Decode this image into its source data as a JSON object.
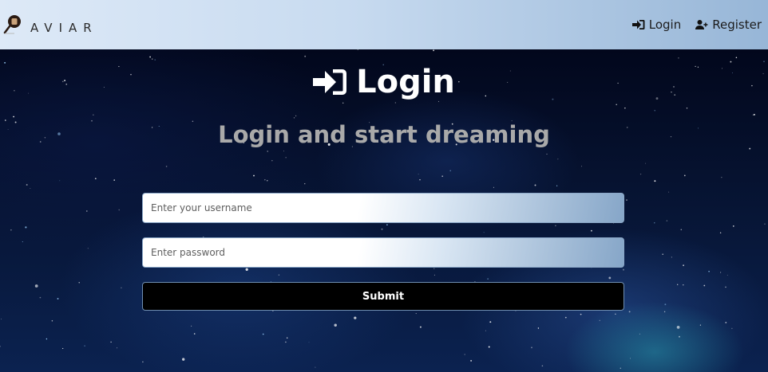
{
  "brand": {
    "name": "AVIAR"
  },
  "nav": {
    "login_label": "Login",
    "register_label": "Register"
  },
  "login": {
    "title": "Login",
    "subtitle": "Login and start dreaming",
    "username_placeholder": "Enter your username",
    "password_placeholder": "Enter password",
    "submit_label": "Submit"
  },
  "icons": {
    "brand": "paintbrush-logo-icon",
    "nav_login": "sign-in-icon",
    "nav_register": "user-plus-icon",
    "title": "sign-in-icon"
  },
  "colors": {
    "navbar_start": "#dde9f7",
    "navbar_end": "#97b6d7",
    "subtitle": "#a9a9a9",
    "button": "#000000"
  }
}
